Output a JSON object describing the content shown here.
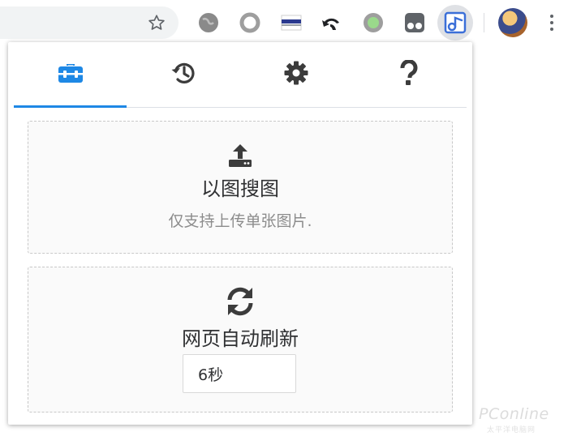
{
  "toolbar": {
    "extensions": [
      "globe-extension",
      "ring-extension",
      "flag-extension",
      "undo-extension",
      "green-dot-extension",
      "tampermonkey-extension",
      "search-by-image-extension"
    ],
    "accent": "#1e88e5"
  },
  "popup": {
    "tabs": [
      {
        "icon": "toolbox-icon",
        "active": true
      },
      {
        "icon": "history-icon",
        "active": false
      },
      {
        "icon": "gear-icon",
        "active": false
      },
      {
        "icon": "question-icon",
        "active": false
      }
    ],
    "upload_card": {
      "icon": "upload-icon",
      "title": "以图搜图",
      "subtitle": "仅支持上传单张图片."
    },
    "refresh_card": {
      "icon": "refresh-icon",
      "title": "网页自动刷新",
      "interval_value": "6秒"
    }
  },
  "watermark": {
    "brand": "PConline",
    "tagline": "太平洋电脑网"
  }
}
